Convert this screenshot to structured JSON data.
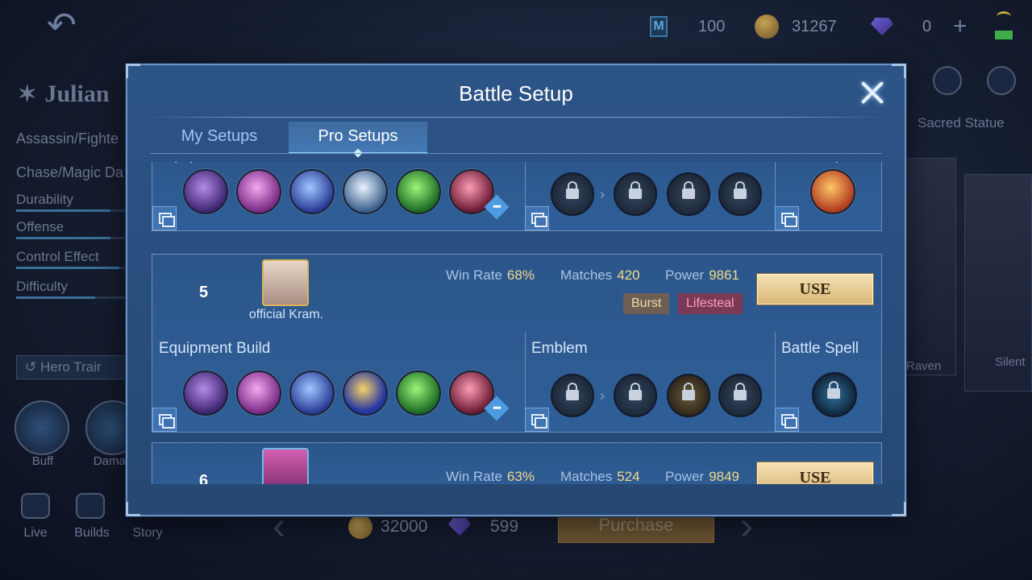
{
  "top_bar": {
    "m_points": "100",
    "coins": "31267",
    "diamonds": "0"
  },
  "hero": {
    "name": "Julian",
    "role": "Assassin/Fighte",
    "chase": "Chase/Magic Da",
    "stats": [
      {
        "label": "Durability",
        "level": 0.78
      },
      {
        "label": "Offense",
        "level": 0.78
      },
      {
        "label": "Control Effect",
        "level": 0.85
      },
      {
        "label": "Difficulty",
        "level": 0.65
      }
    ],
    "train_label": "Hero Trair",
    "skill_buttons": [
      "Buff",
      "Damag"
    ],
    "nav": [
      "Live",
      "Builds",
      "Story"
    ]
  },
  "right_panel": {
    "sacred_statue": "Sacred Statue",
    "skin_names": [
      "Raven",
      "Silent"
    ]
  },
  "bottom": {
    "coin_price": "32000",
    "diamond_price": "599",
    "purchase_label": "Purchase"
  },
  "modal": {
    "title": "Battle Setup",
    "tabs": [
      {
        "label": "My Setups",
        "active": false
      },
      {
        "label": "Pro Setups",
        "active": true
      }
    ],
    "section_labels": {
      "equipment": "Equipment Build",
      "emblem": "Emblem",
      "spell": "Battle Spell"
    },
    "stat_labels": {
      "win_rate": "Win Rate",
      "matches": "Matches",
      "power": "Power"
    },
    "use_label": "USE",
    "entries": [
      {
        "rank": "5",
        "player": "official Kram.",
        "win_rate": "68%",
        "matches": "420",
        "power": "9861",
        "tags": [
          "Burst",
          "Lifesteal"
        ]
      },
      {
        "rank": "6",
        "player": "",
        "win_rate": "63%",
        "matches": "524",
        "power": "9849",
        "tags": []
      }
    ]
  },
  "colors": {
    "modal_bg": "#2d5486",
    "accent_gold": "#f3d98d",
    "use_button": "#d9b775"
  }
}
